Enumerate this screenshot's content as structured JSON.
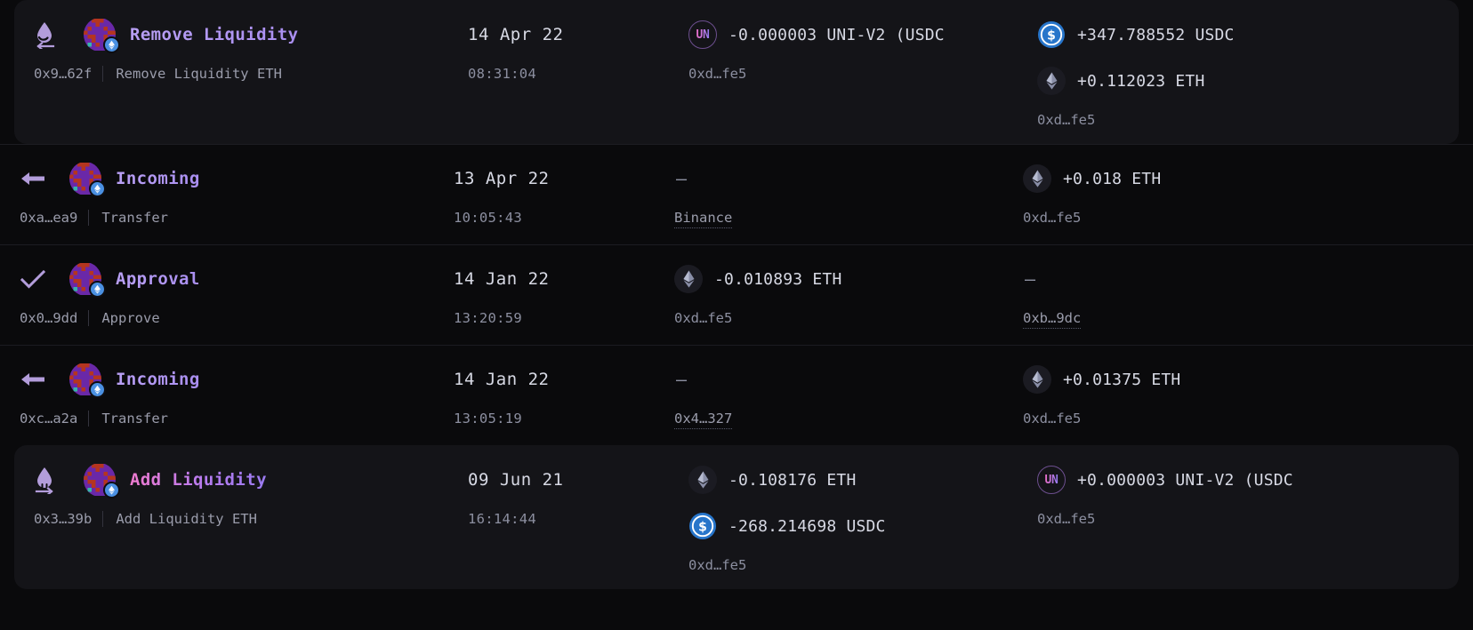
{
  "theme": {
    "background": "#0a0a0c",
    "card_background": "#141418",
    "divider": "#1c1c22",
    "text_primary": "#d7d9e4",
    "text_muted": "#8c8fa0",
    "accent_purple": "#a98ef0",
    "accent_pink": "#f07bd0",
    "usdc_blue": "#2775ca"
  },
  "transactions": [
    {
      "highlighted": true,
      "status_icon": "liquidity-remove-icon",
      "avatar": "wallet-blockie-avatar",
      "chain_badge": "ethereum-badge-icon",
      "title": "Remove Liquidity",
      "title_style": "grad-purple",
      "hash": "0x9…62f",
      "method": "Remove Liquidity ETH",
      "date": "14 Apr 22",
      "time": "08:31:04",
      "sent": {
        "assets": [
          {
            "icon": "uni-token-icon",
            "icon_label": "UN",
            "amount": "-0.000003 UNI-V2 (USDC"
          }
        ],
        "dash": null,
        "address": "0xd…fe5",
        "address_link": false
      },
      "received": {
        "assets": [
          {
            "icon": "usdc-token-icon",
            "icon_label": "",
            "amount": "+347.788552 USDC"
          },
          {
            "icon": "eth-token-icon",
            "icon_label": "",
            "amount": "+0.112023 ETH"
          }
        ],
        "dash": null,
        "address": "0xd…fe5",
        "address_link": false
      }
    },
    {
      "highlighted": false,
      "status_icon": "arrow-left-incoming-icon",
      "avatar": "wallet-blockie-avatar",
      "chain_badge": "ethereum-badge-icon",
      "title": "Incoming",
      "title_style": "grad-purple",
      "hash": "0xa…ea9",
      "method": "Transfer",
      "date": "13 Apr 22",
      "time": "10:05:43",
      "sent": {
        "assets": [],
        "dash": "—",
        "address": "Binance",
        "address_link": true
      },
      "received": {
        "assets": [
          {
            "icon": "eth-token-icon",
            "icon_label": "",
            "amount": "+0.018 ETH"
          }
        ],
        "dash": null,
        "address": "0xd…fe5",
        "address_link": false
      }
    },
    {
      "highlighted": false,
      "status_icon": "checkmark-approval-icon",
      "avatar": "wallet-blockie-avatar",
      "chain_badge": "ethereum-badge-icon",
      "title": "Approval",
      "title_style": "grad-purple",
      "hash": "0x0…9dd",
      "method": "Approve",
      "date": "14 Jan 22",
      "time": "13:20:59",
      "sent": {
        "assets": [
          {
            "icon": "eth-token-icon",
            "icon_label": "",
            "amount": "-0.010893 ETH"
          }
        ],
        "dash": null,
        "address": "0xd…fe5",
        "address_link": false
      },
      "received": {
        "assets": [],
        "dash": "—",
        "address": "0xb…9dc",
        "address_link": true
      }
    },
    {
      "highlighted": false,
      "status_icon": "arrow-left-incoming-icon",
      "avatar": "wallet-blockie-avatar",
      "chain_badge": "ethereum-badge-icon",
      "title": "Incoming",
      "title_style": "grad-purple",
      "hash": "0xc…a2a",
      "method": "Transfer",
      "date": "14 Jan 22",
      "time": "13:05:19",
      "sent": {
        "assets": [],
        "dash": "—",
        "address": "0x4…327",
        "address_link": true
      },
      "received": {
        "assets": [
          {
            "icon": "eth-token-icon",
            "icon_label": "",
            "amount": "+0.01375 ETH"
          }
        ],
        "dash": null,
        "address": "0xd…fe5",
        "address_link": false
      }
    },
    {
      "highlighted": true,
      "status_icon": "liquidity-add-icon",
      "avatar": "wallet-blockie-avatar",
      "chain_badge": "ethereum-badge-icon",
      "title": "Add Liquidity",
      "title_style": "grad-pink",
      "hash": "0x3…39b",
      "method": "Add Liquidity ETH",
      "date": "09 Jun 21",
      "time": "16:14:44",
      "sent": {
        "assets": [
          {
            "icon": "eth-token-icon",
            "icon_label": "",
            "amount": "-0.108176 ETH"
          },
          {
            "icon": "usdc-token-icon",
            "icon_label": "",
            "amount": "-268.214698 USDC"
          }
        ],
        "dash": null,
        "address": "0xd…fe5",
        "address_link": false
      },
      "received": {
        "assets": [
          {
            "icon": "uni-token-icon",
            "icon_label": "UN",
            "amount": "+0.000003 UNI-V2 (USDC"
          }
        ],
        "dash": null,
        "address": "0xd…fe5",
        "address_link": false
      }
    }
  ]
}
